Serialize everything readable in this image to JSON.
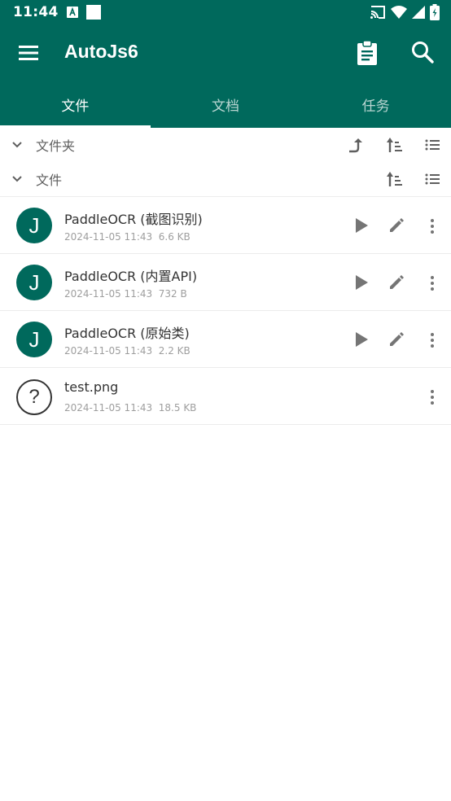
{
  "status_bar": {
    "time": "11:44",
    "icons": [
      "font-a-icon",
      "square-icon",
      "cast-icon",
      "wifi-icon",
      "signal-icon",
      "battery-icon"
    ]
  },
  "app_bar": {
    "title": "AutoJs6",
    "icons": [
      "menu-icon",
      "clipboard-icon",
      "search-icon"
    ]
  },
  "tabs": [
    {
      "label": "文件",
      "active": true
    },
    {
      "label": "文档",
      "active": false
    },
    {
      "label": "任务",
      "active": false
    }
  ],
  "sections": {
    "folders": {
      "label": "文件夹"
    },
    "files": {
      "label": "文件"
    }
  },
  "files": [
    {
      "avatar": "J",
      "name": "PaddleOCR (截图识别)",
      "date": "2024-11-05 11:43",
      "size": "6.6 KB",
      "type": "script"
    },
    {
      "avatar": "J",
      "name": "PaddleOCR (内置API)",
      "date": "2024-11-05 11:43",
      "size": "732 B",
      "type": "script"
    },
    {
      "avatar": "J",
      "name": "PaddleOCR (原始类)",
      "date": "2024-11-05 11:43",
      "size": "2.2 KB",
      "type": "script"
    },
    {
      "avatar": "?",
      "name": "test.png",
      "date": "2024-11-05 11:43",
      "size": "18.5 KB",
      "type": "image"
    }
  ],
  "colors": {
    "primary": "#00695c",
    "icon_grey": "#757575",
    "text_primary": "#333333",
    "text_secondary": "#9e9e9e"
  }
}
